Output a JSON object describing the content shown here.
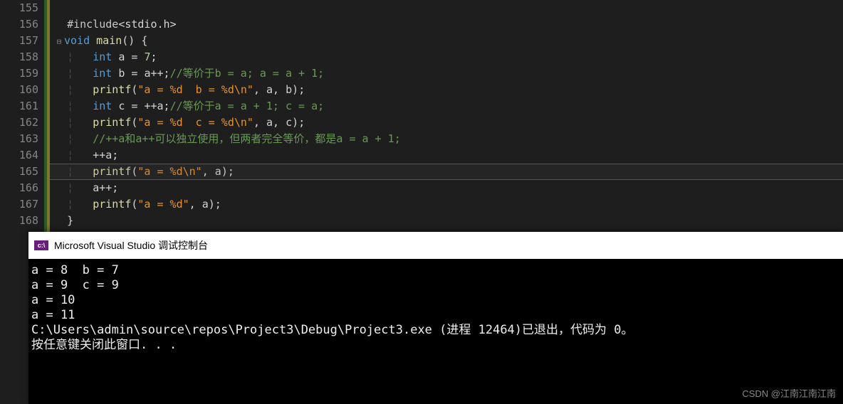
{
  "editor": {
    "lineNumbers": [
      "155",
      "156",
      "157",
      "158",
      "159",
      "160",
      "161",
      "162",
      "163",
      "164",
      "165",
      "166",
      "167",
      "168"
    ],
    "currentLineIndex": 10,
    "code": {
      "l156": {
        "include": "#include",
        "bracket1": "<",
        "header": "stdio.h",
        "bracket2": ">"
      },
      "l157": {
        "kw_void": "void",
        "main": "main",
        "parens": "()",
        "brace": "{"
      },
      "l158": {
        "type": "int",
        "var": "a",
        "eq": "=",
        "num": "7",
        "semi": ";"
      },
      "l159": {
        "type": "int",
        "var": "b",
        "eq": "=",
        "expr": "a++",
        "semi": ";",
        "comment": "//等价于b = a; a = a + 1;"
      },
      "l160": {
        "func": "printf",
        "open": "(",
        "str": "\"a = %d  b = %d\\n\"",
        "comma": ", ",
        "args": "a, b",
        "close": ")",
        "semi": ";"
      },
      "l161": {
        "type": "int",
        "var": "c",
        "eq": "=",
        "expr": "++a",
        "semi": ";",
        "comment": "//等价于a = a + 1; c = a;"
      },
      "l162": {
        "func": "printf",
        "open": "(",
        "str": "\"a = %d  c = %d\\n\"",
        "comma": ", ",
        "args": "a, c",
        "close": ")",
        "semi": ";"
      },
      "l163": {
        "comment": "//++a和a++可以独立使用，但两者完全等价，都是a = a + 1;"
      },
      "l164": {
        "stmt": "++a;"
      },
      "l165": {
        "func": "printf",
        "open": "(",
        "str": "\"a = %d\\n\"",
        "comma": ", ",
        "args": "a",
        "close": ")",
        "semi": ";"
      },
      "l166": {
        "stmt": "a++;"
      },
      "l167": {
        "func": "printf",
        "open": "(",
        "str": "\"a = %d\"",
        "comma": ", ",
        "args": "a",
        "close": ")",
        "semi": ";"
      },
      "l168": {
        "brace": "}"
      }
    }
  },
  "console": {
    "title": "Microsoft Visual Studio 调试控制台",
    "lines": {
      "l1": "a = 8  b = 7",
      "l2": "a = 9  c = 9",
      "l3": "a = 10",
      "l4": "a = 11",
      "l5": "C:\\Users\\admin\\source\\repos\\Project3\\Debug\\Project3.exe (进程 12464)已退出，代码为 0。",
      "l6": "按任意键关闭此窗口. . ."
    }
  },
  "watermark": "CSDN @江南江南江南"
}
